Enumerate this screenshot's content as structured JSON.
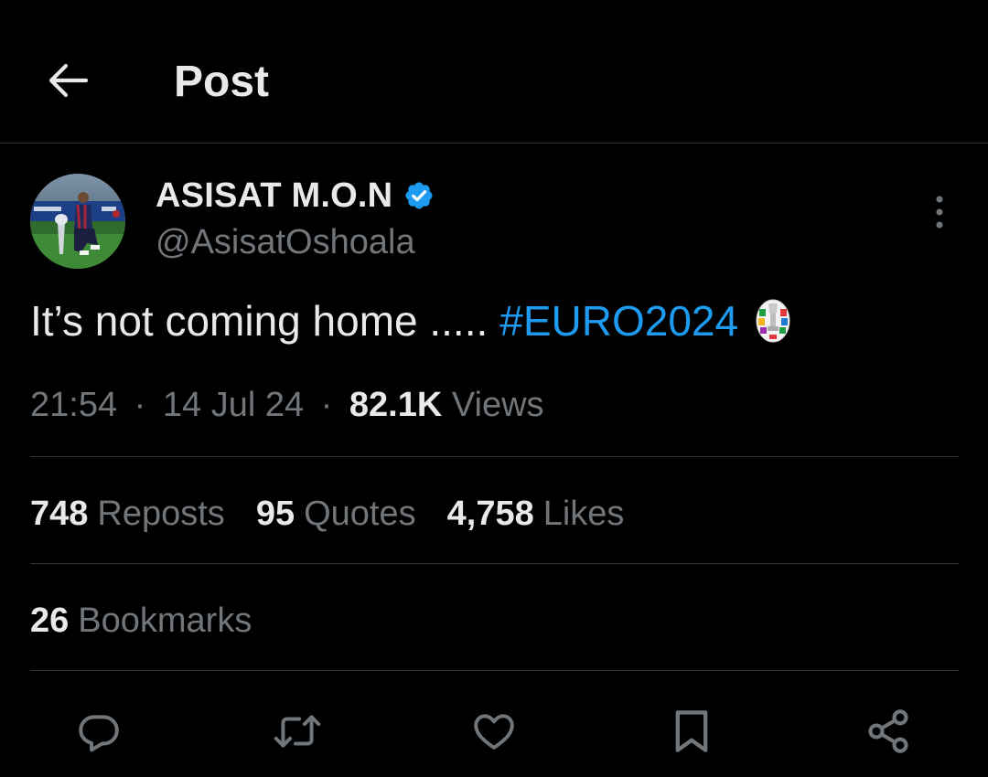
{
  "header": {
    "title": "Post",
    "back_icon": "arrow-left-icon"
  },
  "tweet": {
    "author": {
      "name": "ASISAT M.O.N",
      "handle": "@AsisatOshoala",
      "verified": true,
      "verified_color": "#1d9bf0"
    },
    "text_plain": "It’s not coming home .....",
    "hashtag": "#EURO2024",
    "hashtag_color": "#1d9bf0",
    "time": "21:54",
    "date": "14 Jul 24",
    "views_count": "82.1K",
    "views_label": "Views",
    "separator": "·"
  },
  "stats": {
    "reposts": {
      "count": "748",
      "label": "Reposts"
    },
    "quotes": {
      "count": "95",
      "label": "Quotes"
    },
    "likes": {
      "count": "4,758",
      "label": "Likes"
    },
    "bookmarks": {
      "count": "26",
      "label": "Bookmarks"
    }
  },
  "actions": [
    {
      "icon": "reply-icon"
    },
    {
      "icon": "repost-icon"
    },
    {
      "icon": "like-icon"
    },
    {
      "icon": "bookmark-icon"
    },
    {
      "icon": "share-icon"
    }
  ],
  "colors": {
    "background": "#000000",
    "text_primary": "#e7e9ea",
    "text_secondary": "#71767b",
    "divider": "#2f3336",
    "accent": "#1d9bf0"
  }
}
